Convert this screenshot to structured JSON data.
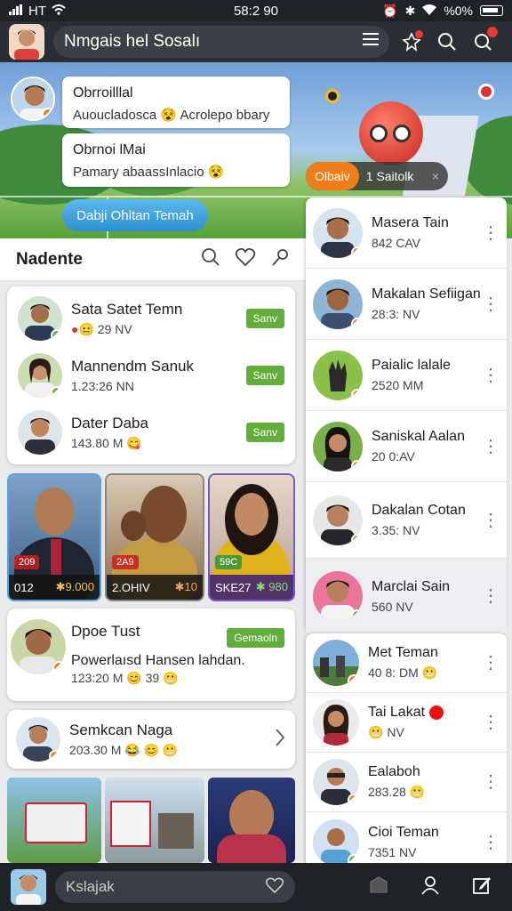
{
  "status_bar": {
    "carrier": "HT",
    "time": "58:2 90",
    "battery": "%0%"
  },
  "header": {
    "title": "Nmgais hel Sosalı",
    "icons": [
      "menu-icon",
      "notification-icon",
      "search-icon",
      "chat-icon"
    ]
  },
  "banner": {
    "bubble1": {
      "title": "Obrroilllal",
      "subtitle": "Auoucladosca",
      "subtitle2": "Acrolepo bbary"
    },
    "bubble2": {
      "title": "Obrnoi lMai",
      "subtitle": "Pamary abaassInlacio"
    },
    "join_button": "Dabji Ohltan Temah",
    "chip": {
      "tag": "Olbaiv",
      "label": "1 Saitolk",
      "close": "×"
    }
  },
  "section": {
    "title": "Nadente",
    "icons": [
      "search-icon",
      "heart-icon",
      "pin-icon"
    ]
  },
  "feed_list": [
    {
      "name": "Sata Satet Temn",
      "meta": "29 NV",
      "badge": "Sanv"
    },
    {
      "name": "Mannendm Sanuk",
      "meta": "1.23:26 NN",
      "badge": "Sanv"
    },
    {
      "name": "Dater Daba",
      "meta": "143.80 M",
      "badge": "Sanv"
    }
  ],
  "tiles": [
    {
      "tag": "209",
      "left": "012",
      "right": "✱9.000"
    },
    {
      "tag": "2A9",
      "left": "2.OHIV",
      "right": "✱10"
    },
    {
      "tag": "59C",
      "left": "SKE27",
      "right": "✱ 980"
    }
  ],
  "feature_card": {
    "name": "Dpoe Tust",
    "description": "Powerlaısd Hansen lahdan.",
    "meta": "123:20 M",
    "count": "39",
    "badge": "Gemaoln"
  },
  "small_card": {
    "name": "Semkcan Naga",
    "meta": "203.30 M"
  },
  "contacts": [
    {
      "name": "Masera Tain",
      "sub": "842 CAV"
    },
    {
      "name": "Makalan Sefiigan",
      "sub": "28:3: NV"
    },
    {
      "name": "Paialic lalale",
      "sub": "2520 MM"
    },
    {
      "name": "Saniskal Aalan",
      "sub": "20 0:AV"
    },
    {
      "name": "Dakalan Cotan",
      "sub": "3.35: NV"
    },
    {
      "name": "Marclai Sain",
      "sub": "560 NV"
    }
  ],
  "contacts2": [
    {
      "name": "Met Teman",
      "sub": "40 8: DM"
    },
    {
      "name": "Tai Lakat",
      "sub": "NV"
    },
    {
      "name": "Ealaboh",
      "sub": "283.28"
    },
    {
      "name": "Cioi Teman",
      "sub": "7351 NV"
    }
  ],
  "bottom_bar": {
    "composer_text": "Kslajak",
    "icons": [
      "heart-icon",
      "folder-icon",
      "profile-icon",
      "edit-icon"
    ]
  },
  "colors": {
    "accent_green": "#62ae3a",
    "accent_blue": "#2c8fd2",
    "accent_orange": "#ef7d1a",
    "dark_bar": "#1f2226"
  }
}
